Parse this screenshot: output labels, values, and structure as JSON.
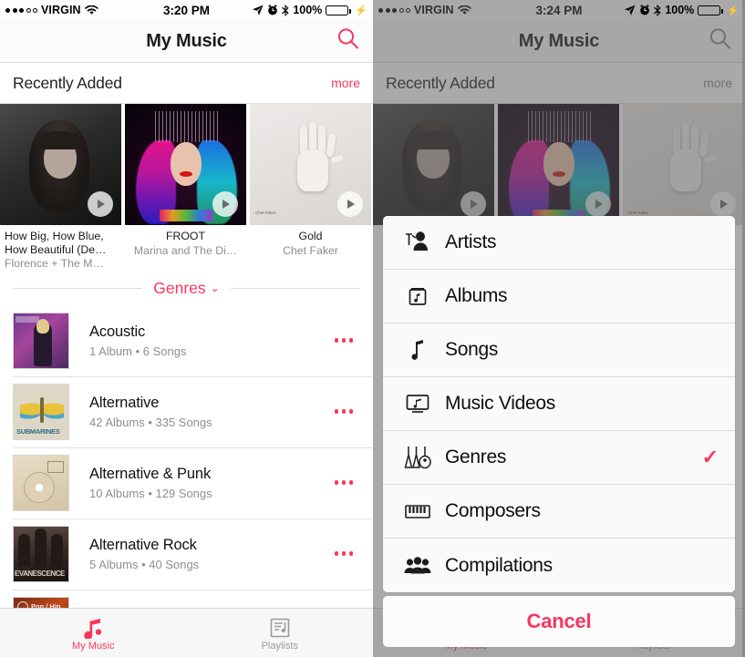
{
  "accent": "#F8365E",
  "left": {
    "status": {
      "carrier": "VIRGIN",
      "signal_filled": 3,
      "signal_total": 5,
      "time": "3:20 PM",
      "battery_percent": "100%",
      "icons": [
        "location-arrow-icon",
        "alarm-clock-icon",
        "bluetooth-icon",
        "battery-icon",
        "charging-bolt-icon"
      ]
    },
    "nav": {
      "title": "My Music",
      "search": "search-icon"
    },
    "section": {
      "title": "Recently Added",
      "more": "more"
    },
    "albums": [
      {
        "title": "How Big, How Blue, How Beautiful (De…",
        "artist": "Florence + The M…",
        "art": "art-florence"
      },
      {
        "title": "FROOT",
        "artist": "Marina and The Di…",
        "art": "art-froot"
      },
      {
        "title": "Gold",
        "artist": "Chet Faker",
        "art": "art-hand"
      }
    ],
    "genres_button": {
      "label": "Genres",
      "chevron": "chevron-down-icon"
    },
    "rows": [
      {
        "title": "Acoustic",
        "subtitle": "1 Album • 6 Songs",
        "art": "th-acoustic"
      },
      {
        "title": "Alternative",
        "subtitle": "42 Albums • 335 Songs",
        "art": "th-alt"
      },
      {
        "title": "Alternative & Punk",
        "subtitle": "10 Albums • 129 Songs",
        "art": "th-punk"
      },
      {
        "title": "Alternative Rock",
        "subtitle": "5 Albums • 40 Songs",
        "art": "th-evan"
      }
    ],
    "tabs": [
      {
        "label": "My Music",
        "icon": "music-note-icon",
        "active": true
      },
      {
        "label": "Playlists",
        "icon": "playlist-icon",
        "active": false
      }
    ]
  },
  "right": {
    "status": {
      "carrier": "VIRGIN",
      "time": "3:24 PM",
      "battery_percent": "100%"
    },
    "nav": {
      "title": "My Music"
    },
    "section": {
      "title": "Recently Added",
      "more": "more"
    },
    "sheet": {
      "items": [
        {
          "label": "Artists",
          "icon": "artist-microphone-icon",
          "checked": false
        },
        {
          "label": "Albums",
          "icon": "album-icon",
          "checked": false
        },
        {
          "label": "Songs",
          "icon": "music-note-icon",
          "checked": false
        },
        {
          "label": "Music Videos",
          "icon": "music-video-icon",
          "checked": false
        },
        {
          "label": "Genres",
          "icon": "guitars-icon",
          "checked": true
        },
        {
          "label": "Composers",
          "icon": "piano-icon",
          "checked": false
        },
        {
          "label": "Compilations",
          "icon": "people-icon",
          "checked": false
        }
      ],
      "checkmark": "✓",
      "cancel": "Cancel"
    },
    "tabs": [
      {
        "label": "My Music",
        "active": true
      },
      {
        "label": "Playlists",
        "active": false
      }
    ]
  }
}
